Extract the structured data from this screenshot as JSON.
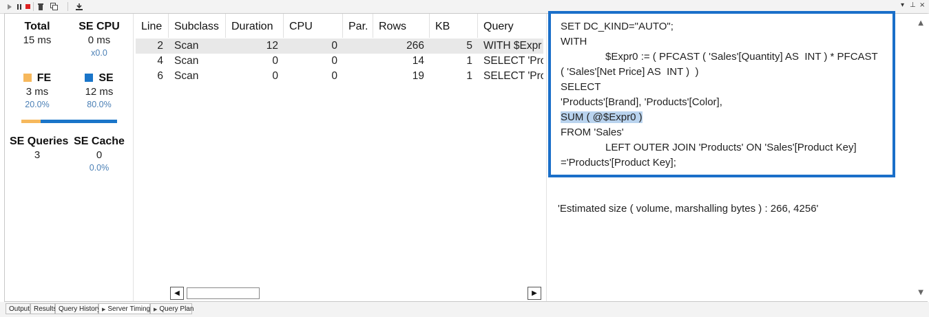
{
  "toolbar": {
    "icons": [
      "play-icon",
      "pause-icon",
      "stop-icon",
      "clear-icon",
      "copy-icon",
      "export-icon"
    ],
    "window_controls": [
      "▾",
      "⊥",
      "×"
    ]
  },
  "summary": {
    "total": {
      "label": "Total",
      "value": "15 ms"
    },
    "se_cpu": {
      "label": "SE CPU",
      "value": "0 ms",
      "sub": "x0.0"
    },
    "fe": {
      "label": "FE",
      "value": "3 ms",
      "pct": "20.0%",
      "color": "#f6b85c"
    },
    "se": {
      "label": "SE",
      "value": "12 ms",
      "pct": "80.0%",
      "color": "#1a75c9"
    },
    "fe_fraction": 0.2,
    "se_queries": {
      "label": "SE Queries",
      "value": "3"
    },
    "se_cache": {
      "label": "SE Cache",
      "value": "0",
      "pct": "0.0%"
    }
  },
  "grid": {
    "columns": [
      "Line",
      "Subclass",
      "Duration",
      "CPU",
      "Par.",
      "Rows",
      "KB",
      "Query"
    ],
    "rows": [
      {
        "line": "2",
        "subclass": "Scan",
        "duration": "12",
        "cpu": "0",
        "par": "",
        "rows": "266",
        "kb": "5",
        "query": "WITH $Expr",
        "selected": true
      },
      {
        "line": "4",
        "subclass": "Scan",
        "duration": "0",
        "cpu": "0",
        "par": "",
        "rows": "14",
        "kb": "1",
        "query": "SELECT 'Pro",
        "selected": false
      },
      {
        "line": "6",
        "subclass": "Scan",
        "duration": "0",
        "cpu": "0",
        "par": "",
        "rows": "19",
        "kb": "1",
        "query": "SELECT 'Pro",
        "selected": false
      }
    ],
    "scroll_left": "◀",
    "scroll_right": "▶"
  },
  "query": {
    "lines": [
      "SET DC_KIND=\"AUTO\";",
      "WITH",
      "$Expr0 := ( PFCAST ( 'Sales'[Quantity] AS  INT ) * PFCAST",
      "( 'Sales'[Net Price] AS  INT )  )",
      "SELECT",
      "'Products'[Brand], 'Products'[Color],",
      "SUM ( @$Expr0 )",
      "FROM 'Sales'",
      "LEFT OUTER JOIN 'Products' ON 'Sales'[Product Key]",
      "='Products'[Product Key];"
    ],
    "estimated": "'Estimated size ( volume, marshalling bytes ) : 266, 4256'",
    "highlight_color": "#b9d3ee",
    "box_color": "#1a6fc9"
  },
  "tabs": [
    {
      "label": "Output",
      "active": false,
      "arrow": false
    },
    {
      "label": "Results",
      "active": false,
      "arrow": false
    },
    {
      "label": "Query History",
      "active": false,
      "arrow": false
    },
    {
      "label": "Server Timings",
      "active": true,
      "arrow": true
    },
    {
      "label": "Query Plan",
      "active": false,
      "arrow": true
    }
  ]
}
